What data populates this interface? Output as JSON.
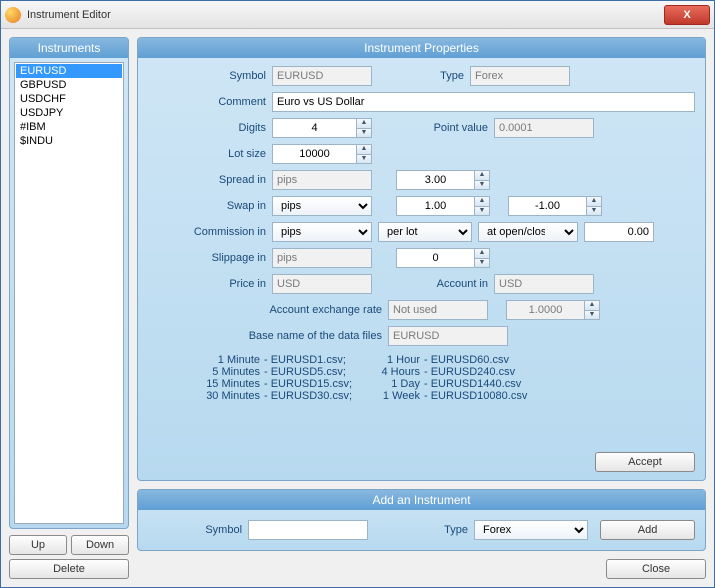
{
  "window": {
    "title": "Instrument Editor",
    "close_glyph": "X"
  },
  "sidebar": {
    "header": "Instruments",
    "items": [
      "EURUSD",
      "GBPUSD",
      "USDCHF",
      "USDJPY",
      "#IBM",
      "$INDU"
    ],
    "selected_index": 0,
    "up": "Up",
    "down": "Down",
    "delete": "Delete"
  },
  "props": {
    "header": "Instrument Properties",
    "labels": {
      "symbol": "Symbol",
      "type": "Type",
      "comment": "Comment",
      "digits": "Digits",
      "point_value": "Point value",
      "lot_size": "Lot size",
      "spread_in": "Spread in",
      "swap_in": "Swap in",
      "commission_in": "Commission in",
      "slippage_in": "Slippage in",
      "price_in": "Price in",
      "account_in": "Account in",
      "account_ex_rate": "Account exchange rate",
      "base_name": "Base name of the data files"
    },
    "values": {
      "symbol": "EURUSD",
      "type": "Forex",
      "comment": "Euro vs US Dollar",
      "digits": "4",
      "point_value": "0.0001",
      "lot_size": "10000",
      "spread_unit": "pips",
      "spread": "3.00",
      "swap_unit": "pips",
      "swap_long": "1.00",
      "swap_short": "-1.00",
      "comm_unit": "pips",
      "comm_per": "per lot",
      "comm_when": "at open/close",
      "comm_val": "0.00",
      "slippage_unit": "pips",
      "slippage": "0",
      "price_in": "USD",
      "account_in": "USD",
      "ex_rate_mode": "Not used",
      "ex_rate_val": "1.0000",
      "base_name": "EURUSD"
    },
    "files": {
      "c1l": [
        "1 Minute",
        "5 Minutes",
        "15 Minutes",
        "30 Minutes"
      ],
      "c1v": [
        "EURUSD1.csv;",
        "EURUSD5.csv;",
        "EURUSD15.csv;",
        "EURUSD30.csv;"
      ],
      "c2l": [
        "1 Hour",
        "4 Hours",
        "1 Day",
        "1 Week"
      ],
      "c2v": [
        "EURUSD60.csv",
        "EURUSD240.csv",
        "EURUSD1440.csv",
        "EURUSD10080.csv"
      ]
    },
    "accept": "Accept"
  },
  "add": {
    "header": "Add an Instrument",
    "labels": {
      "symbol": "Symbol",
      "type": "Type"
    },
    "values": {
      "symbol": "",
      "type": "Forex"
    },
    "add": "Add"
  },
  "footer": {
    "close": "Close"
  }
}
